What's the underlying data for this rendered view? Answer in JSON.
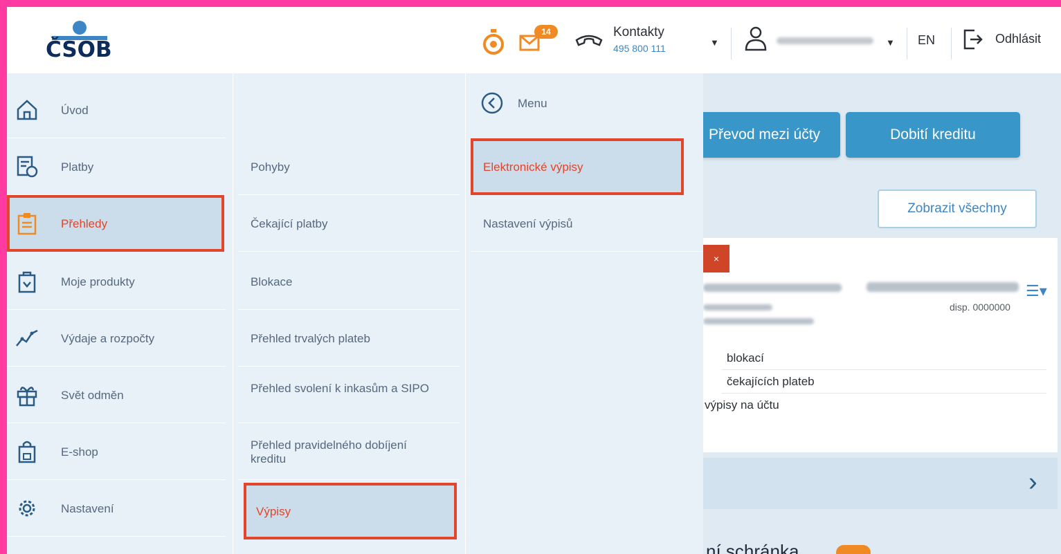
{
  "header": {
    "logo_text": "ČSOB",
    "mail_badge": "14",
    "contacts_label": "Kontakty",
    "contacts_phone": "495 800 111",
    "lang": "EN",
    "logout_label": "Odhlásit"
  },
  "menu": {
    "main_items": [
      {
        "label": "Úvod",
        "icon": "home-icon"
      },
      {
        "label": "Platby",
        "icon": "payments-icon"
      },
      {
        "label": "Přehledy",
        "icon": "clipboard-icon",
        "active": true
      },
      {
        "label": "Moje produkty",
        "icon": "products-icon"
      },
      {
        "label": "Výdaje a rozpočty",
        "icon": "chart-icon"
      },
      {
        "label": "Svět odměn",
        "icon": "gift-icon"
      },
      {
        "label": "E-shop",
        "icon": "shop-icon"
      },
      {
        "label": "Nastavení",
        "icon": "settings-icon"
      }
    ],
    "sub_items": [
      {
        "label": "Pohyby"
      },
      {
        "label": "Čekající platby"
      },
      {
        "label": "Blokace"
      },
      {
        "label": "Přehled trvalých plateb"
      },
      {
        "label": "Přehled svolení k inkasům a SIPO"
      },
      {
        "label": "Přehled pravidelného dobíjení kreditu"
      },
      {
        "label": "Výpisy",
        "active": true
      }
    ],
    "third_back_label": "Menu",
    "third_items": [
      {
        "label": "Elektronické výpisy",
        "active": true
      },
      {
        "label": "Nastavení výpisů"
      }
    ]
  },
  "content": {
    "transfer_button": "Převod mezi účty",
    "topup_button": "Dobití kreditu",
    "show_all_button": "Zobrazit všechny",
    "card_number": "disp. 0000000",
    "links": [
      "blokací",
      "čekajících plateb",
      "výpisy na účtu"
    ],
    "bottom_text": "ní schránka"
  },
  "colors": {
    "accent_red": "#e2452a",
    "primary_blue": "#3996c9",
    "badge_orange": "#f08a24",
    "frame_pink": "#ff3aa0"
  }
}
